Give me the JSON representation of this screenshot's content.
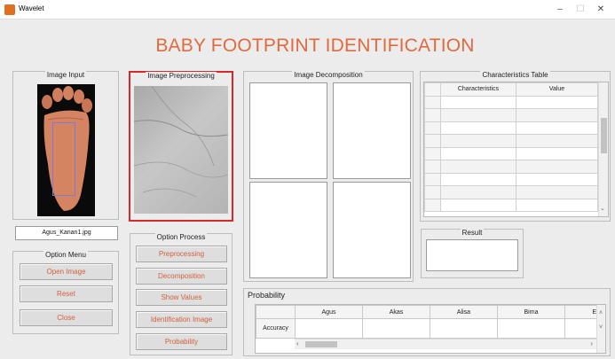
{
  "window": {
    "title": "Wavelet",
    "controls": {
      "minimize": "–",
      "maximize": "☐",
      "close": "✕"
    }
  },
  "app_title": "BABY FOOTPRINT IDENTIFICATION",
  "image_input": {
    "title": "Image Input",
    "filename": "Agus_Kanan1.jpg"
  },
  "image_preprocessing": {
    "title": "Image Preprocessing"
  },
  "image_decomposition": {
    "title": "Image Decomposition"
  },
  "characteristics_table": {
    "title": "Characteristics Table",
    "columns": [
      "Characteristics",
      "Value"
    ]
  },
  "result": {
    "title": "Result"
  },
  "option_menu": {
    "title": "Option Menu",
    "buttons": [
      "Open Image",
      "Reset",
      "Close"
    ]
  },
  "option_process": {
    "title": "Option Process",
    "buttons": [
      "Preprocessing",
      "Decomposition",
      "Show Values",
      "Identification Image",
      "Probability"
    ]
  },
  "probability": {
    "title": "Probability",
    "columns": [
      "Agus",
      "Akas",
      "Alisa",
      "Bima",
      "E"
    ],
    "row_label": "Accuracy"
  },
  "colors": {
    "accent_text": "#d2603c",
    "app_title": "#e06a3e",
    "highlight_border": "#d42a2a",
    "roi_box": "#7a7ad8"
  },
  "icons": {
    "app": "matlab-icon",
    "scroll_up": "chevron-up-icon",
    "scroll_down": "chevron-down-icon",
    "scroll_left": "chevron-left-icon",
    "scroll_right": "chevron-right-icon"
  }
}
